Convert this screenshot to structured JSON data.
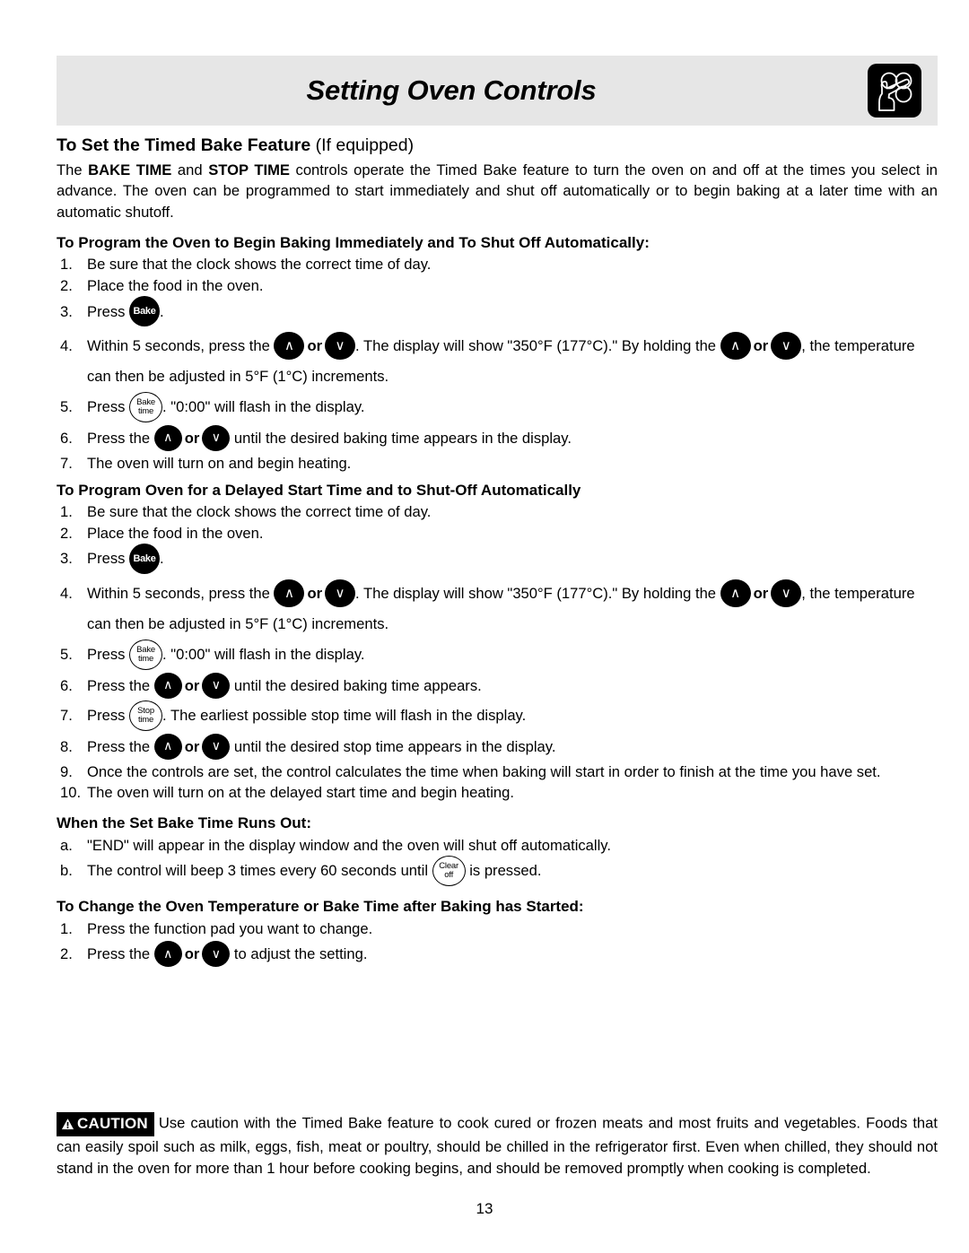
{
  "header": {
    "title": "Setting Oven Controls",
    "icon": "hand-pressing-controls-icon"
  },
  "sections": {
    "timed_bake": {
      "heading_bold": "To Set the Timed Bake Feature",
      "heading_regular": " (If equipped)",
      "intro_1": "The ",
      "intro_bold_1": "BAKE TIME",
      "intro_2": " and ",
      "intro_bold_2": "STOP TIME",
      "intro_3": " controls operate the Timed Bake feature to turn the oven on and off at the times you select in advance. The oven can be programmed to start immediately and shut off automatically or to begin baking at a later time with an automatic shutoff."
    },
    "immediate": {
      "heading": "To Program the Oven to Begin Baking Immediately and To Shut Off Automatically:",
      "steps": [
        {
          "num": "1.",
          "text": "Be sure that the clock shows the correct time of day."
        },
        {
          "num": "2.",
          "text": "Place the food in the oven."
        },
        {
          "num": "3.",
          "pre": "Press ",
          "post": "."
        },
        {
          "num": "4.",
          "t1": "Within 5 seconds, press the ",
          "t2": ". The display will show \"350°F (177°C).\" By holding the ",
          "t3": ", the temperature can then be adjusted in 5°F (1°C) increments."
        },
        {
          "num": "5.",
          "pre": "Press ",
          "post": ". \"0:00\" will flash in the display."
        },
        {
          "num": "6.",
          "pre": "Press the ",
          "post": " until the desired baking time appears in the display."
        },
        {
          "num": "7.",
          "text": "The oven will turn on and begin heating."
        }
      ]
    },
    "delayed": {
      "heading": "To Program Oven for a Delayed Start Time and to Shut-Off Automatically",
      "steps": [
        {
          "num": "1.",
          "text": "Be sure that the clock shows the correct time of day."
        },
        {
          "num": "2.",
          "text": "Place the food in the oven."
        },
        {
          "num": "3.",
          "pre": "Press ",
          "post": "."
        },
        {
          "num": "4.",
          "t1": "Within 5 seconds, press the ",
          "t2": ". The display will show \"350°F (177°C).\" By holding the ",
          "t3": ", the temperature can then be adjusted in 5°F (1°C) increments."
        },
        {
          "num": "5.",
          "pre": "Press ",
          "post": ". \"0:00\" will flash in the display."
        },
        {
          "num": "6.",
          "pre": "Press the ",
          "post": " until the desired baking time appears."
        },
        {
          "num": "7.",
          "pre": "Press ",
          "post": ". The earliest possible stop time will flash in the display."
        },
        {
          "num": "8.",
          "pre": "Press the ",
          "post": " until the desired stop time appears in the display."
        },
        {
          "num": "9.",
          "text": "Once the controls are set, the control calculates the time when baking will start in order to finish at the time you have set."
        },
        {
          "num": "10.",
          "text": "The oven will turn on at the delayed start time and begin heating."
        }
      ]
    },
    "runs_out": {
      "heading": "When the Set Bake Time Runs Out:",
      "steps": [
        {
          "num": "a.",
          "text": "\"END\" will appear in the display window and the oven will shut off automatically."
        },
        {
          "num": "b.",
          "pre": "The control will beep 3 times every 60 seconds until ",
          "post": " is pressed."
        }
      ]
    },
    "change": {
      "heading": "To Change the Oven Temperature or Bake Time after Baking has Started:",
      "steps": [
        {
          "num": "1.",
          "text": "Press the function pad you want to change."
        },
        {
          "num": "2.",
          "pre": "Press the ",
          "post": " to adjust the setting."
        }
      ]
    }
  },
  "keys": {
    "bake": "Bake",
    "bake_time_line1": "Bake",
    "bake_time_line2": "time",
    "stop_time_line1": "Stop",
    "stop_time_line2": "time",
    "clear_off_line1": "Clear",
    "clear_off_line2": "off",
    "arrow_up": "∧",
    "arrow_down": "∨",
    "or": "or"
  },
  "caution": {
    "badge_label": "CAUTION",
    "text": "Use caution with the Timed Bake feature to cook cured or frozen meats and most fruits and vegetables. Foods that can easily spoil such as milk, eggs, fish, meat or poultry, should be chilled in the refrigerator first. Even when chilled, they should not stand in the oven for more than 1 hour before cooking begins, and should be removed promptly when cooking is completed."
  },
  "footer": {
    "page_number": "13"
  },
  "colors": {
    "header_band": "#e6e6e6",
    "ink": "#000000",
    "paper": "#ffffff"
  }
}
